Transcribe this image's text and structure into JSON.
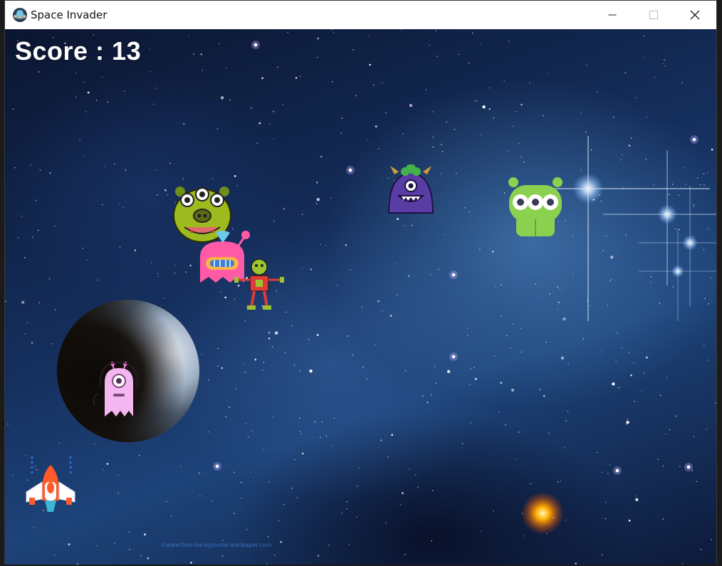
{
  "window": {
    "title": "Space Invader",
    "controls": {
      "minimize": "minimize-icon",
      "maximize": "maximize-icon",
      "close": "close-icon"
    }
  },
  "game": {
    "score_label": "Score : 13",
    "score": 13,
    "watermark": "©www.free-background-wallpaper.com",
    "enemies": [
      {
        "kind": "yellow-green-three-eyed-alien"
      },
      {
        "kind": "pink-one-eyed-monster"
      },
      {
        "kind": "green-antenna-robot-alien"
      },
      {
        "kind": "purple-cyclops-monster"
      },
      {
        "kind": "green-three-eyed-alien"
      },
      {
        "kind": "pink-one-eyed-octopus-alien"
      }
    ],
    "player": {
      "kind": "rocket-ship"
    },
    "colors": {
      "space_dark": "#0b1530",
      "space_mid": "#1d4379",
      "score_text": "#ffffff"
    }
  }
}
